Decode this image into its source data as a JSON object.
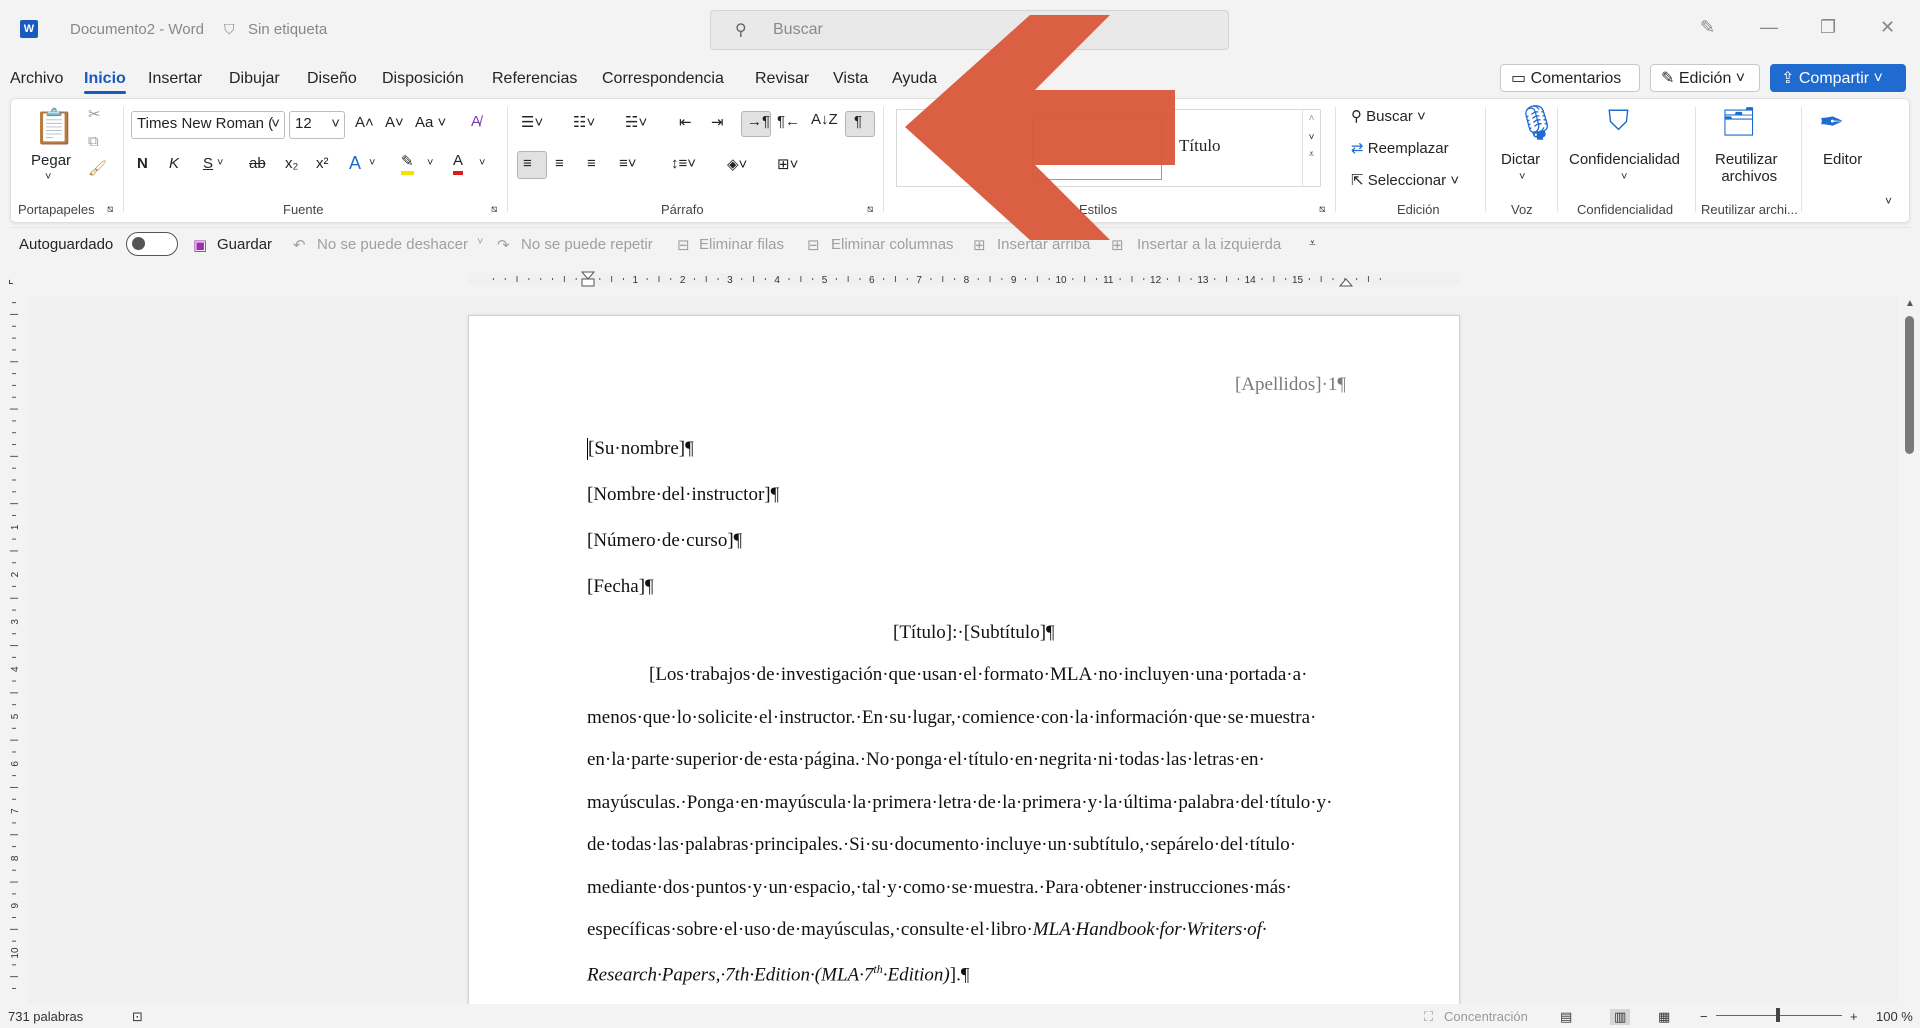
{
  "titlebar": {
    "app_icon": "W",
    "doc_title": "Documento2  -  Word",
    "sensitivity": "Sin etiqueta",
    "search_placeholder": "Buscar"
  },
  "tabs": [
    "Archivo",
    "Inicio",
    "Insertar",
    "Dibujar",
    "Diseño",
    "Disposición",
    "Referencias",
    "Correspondencia",
    "Revisar",
    "Vista",
    "Ayuda"
  ],
  "top_buttons": {
    "comments": "Comentarios",
    "editing": "Edición",
    "share": "Compartir"
  },
  "ribbon": {
    "clipboard": {
      "paste": "Pegar",
      "group": "Portapapeles"
    },
    "font": {
      "name": "Times New Roman (",
      "size": "12",
      "group": "Fuente",
      "bold": "N",
      "italic": "K",
      "underline": "S",
      "strike": "ab",
      "sub": "x₂",
      "sup": "x²",
      "case": "Aa"
    },
    "paragraph": {
      "group": "Párrafo"
    },
    "styles": {
      "title_style": "Título",
      "group": "Estilos"
    },
    "editing": {
      "find": "Buscar",
      "replace": "Reemplazar",
      "select": "Seleccionar",
      "group": "Edición"
    },
    "voice": {
      "dictate": "Dictar",
      "group": "Voz"
    },
    "sensitivity": {
      "button": "Confidencialidad",
      "group": "Confidencialidad"
    },
    "reuse": {
      "button_line1": "Reutilizar",
      "button_line2": "archivos",
      "group": "Reutilizar archi..."
    },
    "editor": {
      "button": "Editor"
    }
  },
  "qat": {
    "autosave": "Autoguardado",
    "save": "Guardar",
    "undo": "No se puede deshacer",
    "redo": "No se puede repetir",
    "delete_rows": "Eliminar filas",
    "delete_cols": "Eliminar columnas",
    "insert_above": "Insertar arriba",
    "insert_left": "Insertar a la izquierda"
  },
  "document": {
    "header": "[Apellidos]·1¶",
    "lines": [
      "[Su·nombre]¶",
      "[Nombre·del·instructor]¶",
      "[Número·de·curso]¶",
      "[Fecha]¶"
    ],
    "title_line": "[Título]:·[Subtítulo]¶",
    "body": [
      "[Los·trabajos·de·investigación·que·usan·el·formato·MLA·no·incluyen·una·portada·a·",
      "menos·que·lo·solicite·el·instructor.·En·su·lugar,·comience·con·la·información·que·se·muestra·",
      "en·la·parte·superior·de·esta·página.·No·ponga·el·título·en·negrita·ni·todas·las·letras·en·",
      "mayúsculas.·Ponga·en·mayúscula·la·primera·letra·de·la·primera·y·la·última·palabra·del·título·y·",
      "de·todas·las·palabras·principales.·Si·su·documento·incluye·un·subtítulo,·sepárelo·del·título·",
      "mediante·dos·puntos·y·un·espacio,·tal·y·como·se·muestra.·Para·obtener·instrucciones·más·",
      "específicas·sobre·el·uso·de·mayúsculas,·consulte·el·libro·"
    ],
    "body_italic_1": "MLA·Handbook·for·Writers·of·",
    "body_italic_2": "Research·Papers,·7th·Edition·(MLA·7",
    "body_sup": "th",
    "body_italic_3": "·Edition)",
    "body_end": "].¶"
  },
  "ruler_numbers": [
    "1",
    "2",
    "3",
    "4",
    "5",
    "6",
    "7",
    "8",
    "9",
    "10",
    "11",
    "12",
    "13",
    "14",
    "15"
  ],
  "vruler_numbers": [
    "1",
    "2",
    "3",
    "4",
    "5",
    "6",
    "7",
    "8",
    "9",
    "10",
    "11"
  ],
  "status": {
    "words": "731 palabras",
    "focus": "Concentración",
    "zoom": "100 %"
  },
  "colors": {
    "accent": "#185abd",
    "arrow": "#d9583b",
    "share": "#1f6bd0"
  }
}
